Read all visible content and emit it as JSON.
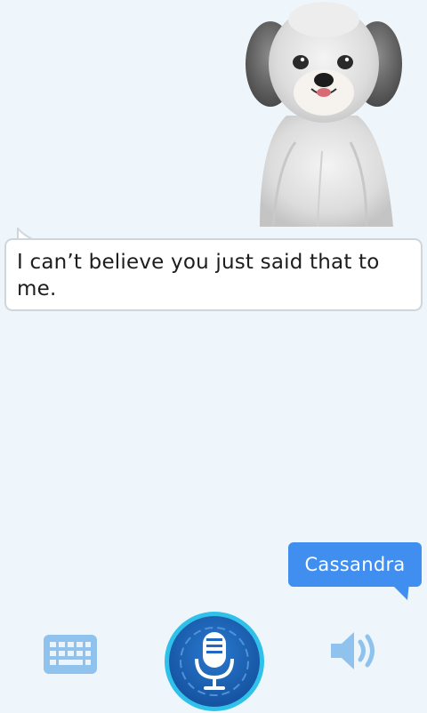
{
  "conversation": {
    "assistant_message": "I can’t believe you just said that to me.",
    "user_message": "Cassandra"
  },
  "controls": {
    "keyboard_icon": "keyboard-icon",
    "mic_icon": "microphone-icon",
    "speaker_icon": "speaker-icon"
  },
  "colors": {
    "background": "#eff6fb",
    "user_bubble": "#3f8ef0",
    "assistant_bubble": "#ffffff",
    "mic_button": "#1b5fae",
    "icon_light_blue": "#8fc2ec"
  }
}
